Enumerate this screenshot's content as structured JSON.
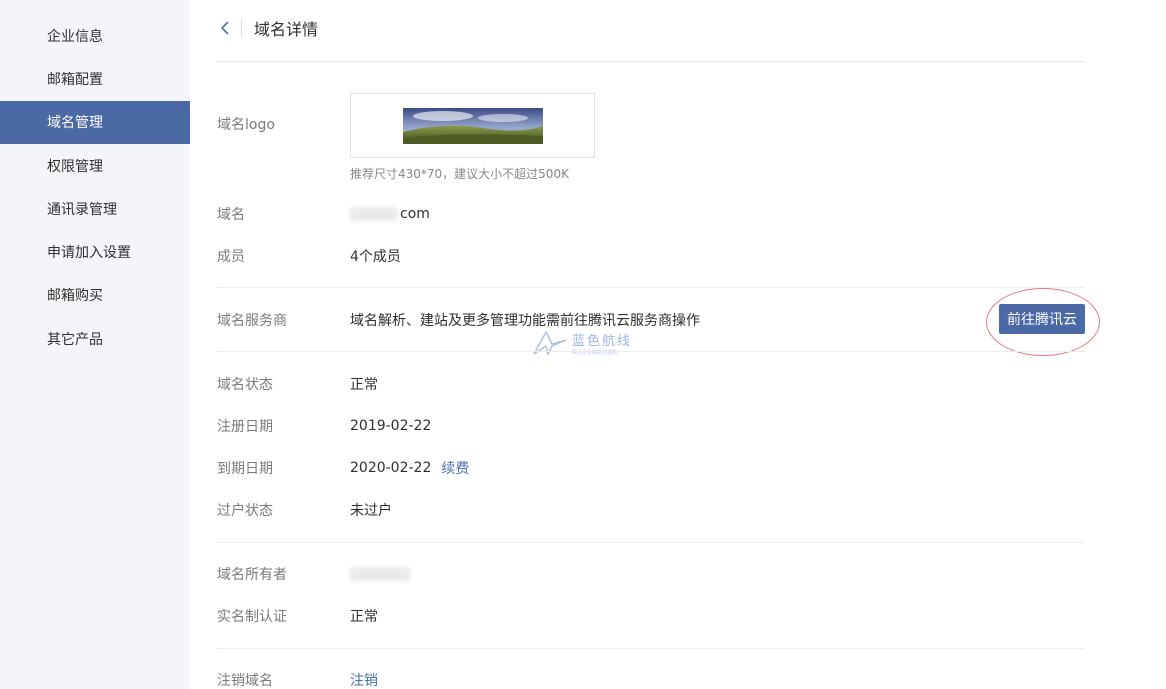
{
  "sidebar": {
    "items": [
      {
        "label": "企业信息"
      },
      {
        "label": "邮箱配置"
      },
      {
        "label": "域名管理"
      },
      {
        "label": "权限管理"
      },
      {
        "label": "通讯录管理"
      },
      {
        "label": "申请加入设置"
      },
      {
        "label": "邮箱购买"
      },
      {
        "label": "其它产品"
      }
    ],
    "active_index": 2
  },
  "header": {
    "title": "域名详情"
  },
  "domain_logo": {
    "label": "域名logo",
    "hint": "推荐尺寸430*70，建议大小不超过500K"
  },
  "domain": {
    "label": "域名",
    "value": "com"
  },
  "members": {
    "label": "成员",
    "value": "4个成员"
  },
  "provider": {
    "label": "域名服务商",
    "value": "域名解析、建站及更多管理功能需前往腾讯云服务商操作",
    "button_label": "前往腾讯云"
  },
  "watermark": {
    "main": "蓝色航线",
    "sub": "腾讯企业邮箱代理商"
  },
  "status": {
    "label": "域名状态",
    "value": "正常"
  },
  "register_date": {
    "label": "注册日期",
    "value": "2019-02-22"
  },
  "expire_date": {
    "label": "到期日期",
    "value": "2020-02-22",
    "link": "续费"
  },
  "transfer_status": {
    "label": "过户状态",
    "value": "未过户"
  },
  "owner": {
    "label": "域名所有者"
  },
  "real_name": {
    "label": "实名制认证",
    "value": "正常"
  },
  "cancel": {
    "label": "注销域名",
    "link": "注销"
  },
  "colors": {
    "accent": "#4b6aa5",
    "link": "#4a6fb0",
    "highlight_ring": "#e07b7b"
  }
}
